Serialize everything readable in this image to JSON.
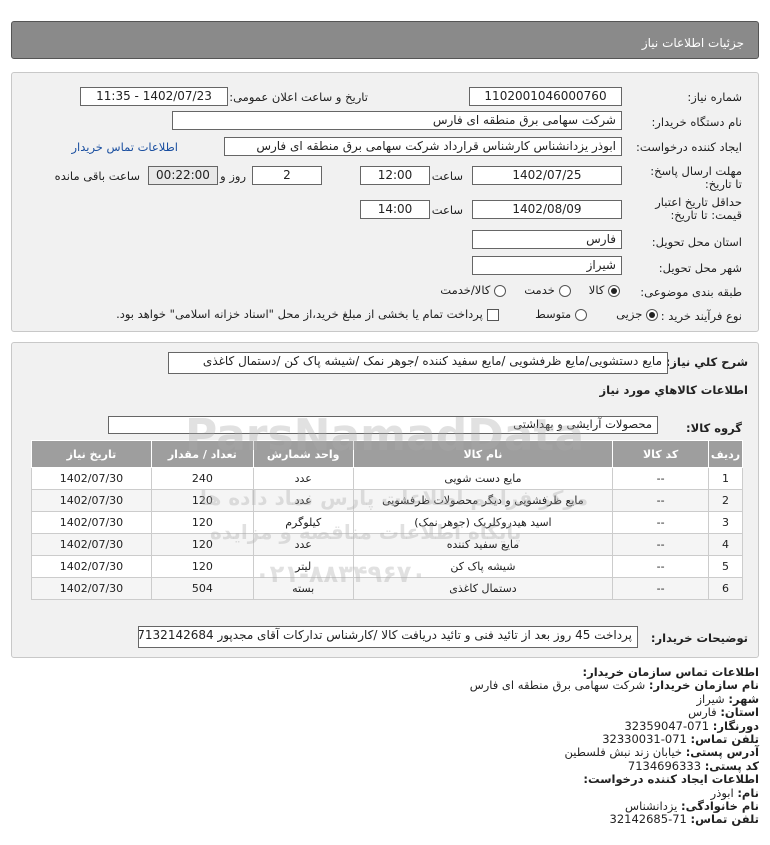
{
  "header": {
    "title": "جزئیات اطلاعات نیاز"
  },
  "form": {
    "need_number_label": "شماره نیاز:",
    "need_number": "1102001046000760",
    "announce_label": "تاریخ و ساعت اعلان عمومی:",
    "announce_value": "1402/07/23 - 11:35",
    "buyer_label": "نام دستگاه خریدار:",
    "buyer_value": "شرکت سهامی برق منطقه ای فارس",
    "creator_label": "ایجاد کننده درخواست:",
    "creator_value": "ابوذر  یزدانشناس کارشناس قرارداد شرکت سهامی برق منطقه ای فارس",
    "contact_link": "اطلاعات تماس خریدار",
    "deadline_label": "مهلت ارسال پاسخ: تا تاریخ:",
    "deadline_date": "1402/07/25",
    "hour_label": "ساعت",
    "deadline_time": "12:00",
    "days_value": "2",
    "days_label": "روز و",
    "remaining_value": "00:22:00",
    "remaining_label": "ساعت باقی مانده",
    "validity_label": "حداقل تاریخ اعتبار قیمت: تا تاریخ:",
    "validity_date": "1402/08/09",
    "validity_time": "14:00",
    "province_label": "استان محل تحویل:",
    "province_value": "فارس",
    "city_label": "شهر محل تحویل:",
    "city_value": "شیراز",
    "category_label": "طبقه بندی موضوعی:",
    "cat_options": [
      "کالا",
      "خدمت",
      "کالا/خدمت"
    ],
    "cat_selected": "کالا",
    "process_label": "نوع فرآیند خرید :",
    "process_options": [
      "جزیی",
      "متوسط"
    ],
    "process_selected": "جزیی",
    "payment_note": "پرداخت تمام یا بخشی از مبلغ خرید،از محل \"اسناد خزانه اسلامی\" خواهد بود."
  },
  "details": {
    "desc_label": "شرح کلي نياز:",
    "desc_value": "مایع دستشویی/مایع ظرفشویی /مایع سفید کننده /جوهر نمک /شیشه پاک کن /دستمال کاغذی",
    "goods_info_title": "اطلاعات کالاهاي مورد نياز",
    "group_label": "گروه کالا:",
    "group_value": "محصولات آرایشی و بهداشتی",
    "columns": [
      "ردیف",
      "کد کالا",
      "نام کالا",
      "واحد شمارش",
      "تعداد / مقدار",
      "تاریخ نیاز"
    ],
    "rows": [
      [
        "1",
        "--",
        "مایع دست شویی",
        "عدد",
        "240",
        "1402/07/30"
      ],
      [
        "2",
        "--",
        "مایع ظرفشویی و دیگر محصولات ظرفشویی",
        "عدد",
        "120",
        "1402/07/30"
      ],
      [
        "3",
        "--",
        "اسید هیدروکلریک (جوهر نمک)",
        "کیلوگرم",
        "120",
        "1402/07/30"
      ],
      [
        "4",
        "--",
        "مایع سفید کننده",
        "عدد",
        "120",
        "1402/07/30"
      ],
      [
        "5",
        "--",
        "شیشه پاک کن",
        "لیتر",
        "120",
        "1402/07/30"
      ],
      [
        "6",
        "--",
        "دستمال کاغذی",
        "بسته",
        "504",
        "1402/07/30"
      ]
    ],
    "buyer_notes_label": "توضیحات خریدار:",
    "buyer_notes_value": "پرداخت 45 روز بعد از تائید فنی و تائید دریافت کالا /کارشناس تدارکات آقای مجدپور 07132142684"
  },
  "contact": {
    "title": "اطلاعات تماس سازمان خریدار:",
    "lines": [
      {
        "label": "نام سازمان خریدار:",
        "value": "شرکت سهامی برق منطقه ای فارس"
      },
      {
        "label": "شهر:",
        "value": "شیراز"
      },
      {
        "label": "استان:",
        "value": "فارس"
      },
      {
        "label": "دورنگار:",
        "value": "071-32359047"
      },
      {
        "label": "تلفن تماس:",
        "value": "071-32330031"
      },
      {
        "label": "آدرس پستی:",
        "value": "خیابان زند نبش فلسطین"
      },
      {
        "label": "کد پستی:",
        "value": "7134696333"
      },
      {
        "label": "اطلاعات ایجاد کننده درخواست:",
        "value": ""
      },
      {
        "label": "نام:",
        "value": "ابوذر"
      },
      {
        "label": "نام خانوادگی:",
        "value": "یزدانشناس"
      },
      {
        "label": "تلفن تماس:",
        "value": "71-32142685"
      }
    ]
  },
  "watermark": [
    "ParsNamadData",
    "مرکز فراهم اطلاعات پارس نماد داده ها",
    "پایگاه اطلاعات مناقصه و مزایده",
    "۰۲۱-۸۸۳۴۹۶۷۰"
  ]
}
